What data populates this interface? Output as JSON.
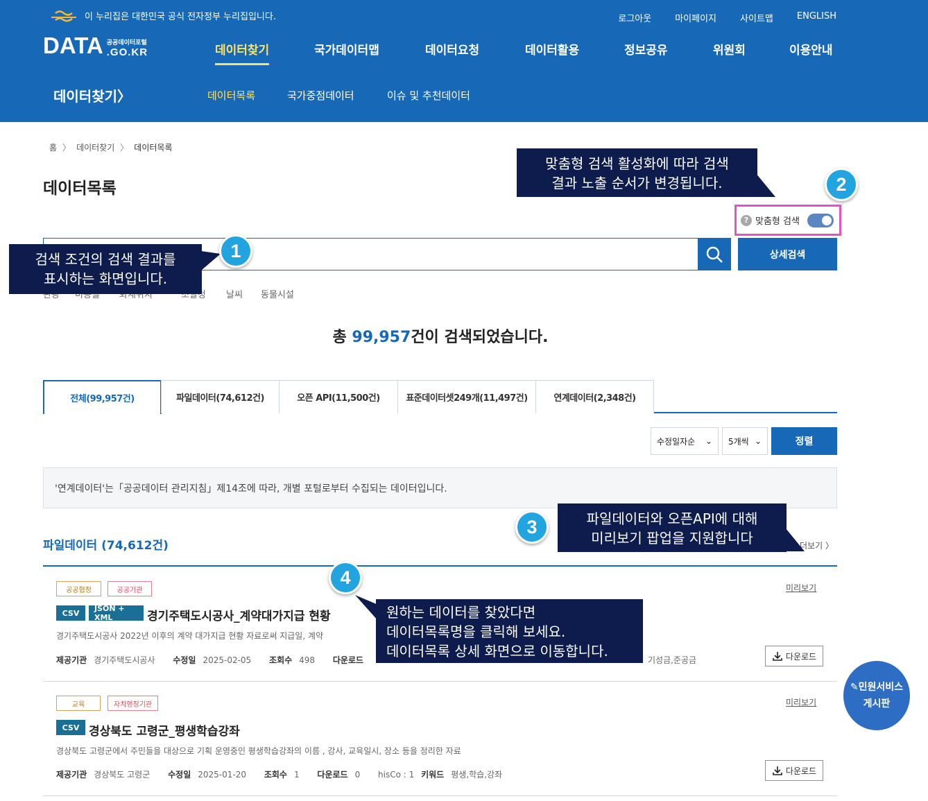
{
  "header": {
    "gov_banner": "이 누리집은 대한민국 공식 전자정부 누리집입니다.",
    "util_menu": [
      "로그아웃",
      "마이페이지",
      "사이트맵",
      "ENGLISH"
    ],
    "brand_main": "DATA",
    "brand_sub": "공공데이터포털",
    "brand_domain": ".GO.KR",
    "gnb": [
      "데이터찾기",
      "국가데이터맵",
      "데이터요청",
      "데이터활용",
      "정보공유",
      "위원회",
      "이용안내"
    ],
    "sub_title": "데이터찾기〉",
    "lnb": [
      "데이터목록",
      "국가중점데이터",
      "이슈 및 추천데이터"
    ]
  },
  "breadcrumb": [
    "홈",
    "데이터찾기",
    "데이터목록"
  ],
  "page_title": "데이터목록",
  "custom_search": {
    "label": "맞춤형 검색",
    "enabled": true,
    "help_icon": "?"
  },
  "search": {
    "placeholder": "",
    "detail_label": "상세검색"
  },
  "keywords": [
    "관광",
    "미용실",
    "화재위치",
    "조달청",
    "날씨",
    "동물시설"
  ],
  "total": {
    "prefix": "총 ",
    "count": "99,957",
    "suffix": "건이 검색되었습니다."
  },
  "tabs": [
    "전체(99,957건)",
    "파일데이터(74,612건)",
    "오픈 API(11,500건)",
    "표준데이터셋249개(11,497건)",
    "연계데이터(2,348건)"
  ],
  "sort": {
    "order": "수정일자순",
    "page_size": "5개씩",
    "button": "정렬"
  },
  "notice": "'연계데이터'는「공공데이터 관리지침」제14조에 따라, 개별 포털로부터 수집되는 데이터입니다.",
  "section": {
    "title": "파일데이터 (74,612건)",
    "more": "더보기 〉"
  },
  "results": [
    {
      "tags": [
        "공공협정",
        "공공기관"
      ],
      "formats": [
        "CSV",
        "JSON + XML"
      ],
      "title": "경기주택도시공사_계약대가지급 현황",
      "desc": "경기주택도시공사 2022년 이후의 계약 대가지급 현황 자료로써 지급일, 계약",
      "provider_label": "제공기관",
      "provider": "경기주택도시공사",
      "modified_label": "수정일",
      "modified": "2025-02-05",
      "views_label": "조회수",
      "views": "498",
      "downloads_label": "다운로드",
      "downloads": "",
      "keywords_tail": "기성금,준공금",
      "preview": "미리보기",
      "download": "다운로드"
    },
    {
      "tags": [
        "교육",
        "자치행정기관"
      ],
      "formats": [
        "CSV"
      ],
      "title": "경상북도 고령군_평생학습강좌",
      "desc": "경상북도 고령군에서 주민들을 대상으로 기획 운영중인 평생학습강좌의 이름 , 강사, 교육일시, 장소 등을 정리한 자료",
      "provider_label": "제공기관",
      "provider": "경상북도 고령군",
      "modified_label": "수정일",
      "modified": "2025-01-20",
      "views_label": "조회수",
      "views": "1",
      "downloads_label": "다운로드",
      "downloads": "0",
      "his": "hisCo : 1",
      "keywords_label": "키워드",
      "keywords": "평생,학습,강좌",
      "preview": "미리보기",
      "download": "다운로드"
    }
  ],
  "callouts": {
    "c1": {
      "num": "1",
      "line1": "검색 조건의 검색 결과를",
      "line2": "표시하는 화면입니다."
    },
    "c2": {
      "num": "2",
      "line1": "맞춤형 검색 활성화에 따라 검색",
      "line2": "결과 노출 순서가 변경됩니다."
    },
    "c3": {
      "num": "3",
      "line1": "파일데이터와 오픈API에 대해",
      "line2": "미리보기 팝업을 지원합니다"
    },
    "c4": {
      "num": "4",
      "line1": "원하는 데이터를 찾았다면",
      "line2": "데이터목록명을 클릭해 보세요.",
      "line3": "데이터목록 상세 화면으로 이동합니다."
    }
  },
  "floating": {
    "line1": "민원서비스",
    "line2": "게시판"
  },
  "colors": {
    "primary": "#1769b8",
    "highlight": "#ffe26a",
    "callout": "#0d1b4d",
    "badge": "#21a4e0"
  }
}
